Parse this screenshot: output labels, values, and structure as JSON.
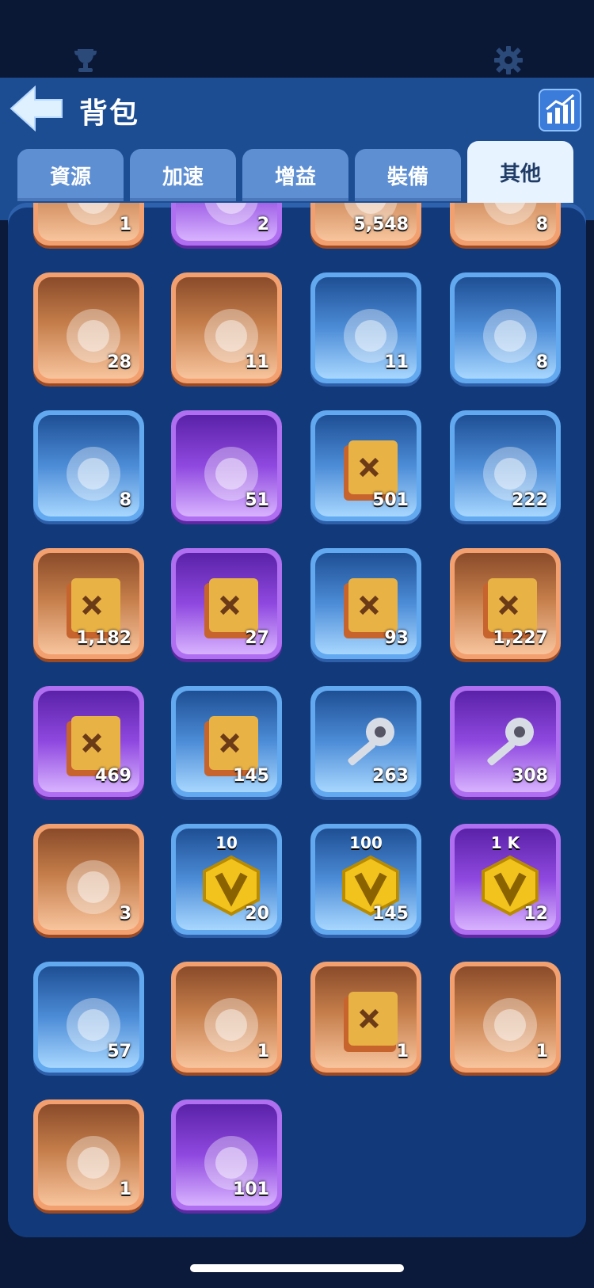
{
  "header": {
    "title": "背包"
  },
  "tabs": [
    {
      "label": "資源"
    },
    {
      "label": "加速"
    },
    {
      "label": "增益"
    },
    {
      "label": "裝備"
    },
    {
      "label": "其他",
      "active": true
    }
  ],
  "items": [
    {
      "icon": "coin-icon",
      "count": "1",
      "rarity": "orange"
    },
    {
      "icon": "purple-item-icon",
      "count": "2",
      "rarity": "purple"
    },
    {
      "icon": "resource-icon",
      "count": "5,548",
      "rarity": "orange"
    },
    {
      "icon": "orange-item-icon",
      "count": "8",
      "rarity": "orange"
    },
    {
      "icon": "treasure-map-icon",
      "count": "28",
      "rarity": "orange"
    },
    {
      "icon": "seashell-icon",
      "count": "11",
      "rarity": "orange"
    },
    {
      "icon": "lantern-icon",
      "count": "11",
      "rarity": "blue"
    },
    {
      "icon": "robot-icon",
      "count": "8",
      "rarity": "blue"
    },
    {
      "icon": "fishing-reel-icon",
      "count": "8",
      "rarity": "blue"
    },
    {
      "icon": "potion-icon",
      "count": "51",
      "rarity": "purple"
    },
    {
      "icon": "paw-book-icon",
      "count": "501",
      "rarity": "blue"
    },
    {
      "icon": "claw-stone-icon",
      "count": "222",
      "rarity": "blue"
    },
    {
      "icon": "battle-book-icon",
      "count": "1,182",
      "rarity": "orange"
    },
    {
      "icon": "battle-book-icon",
      "count": "27",
      "rarity": "purple"
    },
    {
      "icon": "battle-book-icon",
      "count": "93",
      "rarity": "blue"
    },
    {
      "icon": "flag-book-icon",
      "count": "1,227",
      "rarity": "orange"
    },
    {
      "icon": "flag-book-icon",
      "count": "469",
      "rarity": "purple"
    },
    {
      "icon": "flag-book-icon",
      "count": "145",
      "rarity": "blue"
    },
    {
      "icon": "silver-key-icon",
      "count": "263",
      "rarity": "blue"
    },
    {
      "icon": "gold-key-icon",
      "count": "308",
      "rarity": "purple"
    },
    {
      "icon": "ticket-icon",
      "count": "3",
      "rarity": "orange"
    },
    {
      "icon": "v-badge-icon",
      "count": "20",
      "rarity": "blue",
      "label": "10"
    },
    {
      "icon": "v-badge-icon",
      "count": "145",
      "rarity": "blue",
      "label": "100"
    },
    {
      "icon": "v-badge-icon",
      "count": "12",
      "rarity": "purple",
      "label": "1 K"
    },
    {
      "icon": "arrowhead-icon",
      "count": "57",
      "rarity": "blue"
    },
    {
      "icon": "second-place-badge-icon",
      "count": "1",
      "rarity": "orange"
    },
    {
      "icon": "book-2025-icon",
      "count": "1",
      "rarity": "orange"
    },
    {
      "icon": "gift-2025-icon",
      "count": "1",
      "rarity": "orange"
    },
    {
      "icon": "scroll-2024-icon",
      "count": "1",
      "rarity": "orange"
    },
    {
      "icon": "compass-icon",
      "count": "101",
      "rarity": "purple"
    }
  ],
  "colors": {
    "panel": "#123a7a",
    "header": "#1c4d92",
    "topbar": "#0a1735"
  }
}
